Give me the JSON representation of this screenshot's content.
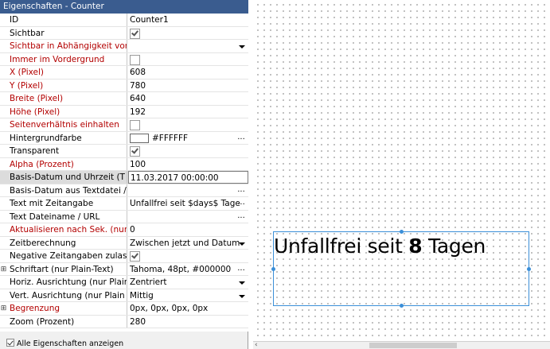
{
  "panel": {
    "title": "Eigenschaften - Counter",
    "show_all_label": "Alle Eigenschaften anzeigen"
  },
  "properties": [
    {
      "name": "ID",
      "value": "Counter1",
      "red": false
    },
    {
      "name": "Sichtbar",
      "value": "",
      "type": "checkbox",
      "checked": true,
      "red": false
    },
    {
      "name": "Sichtbar in Abhängigkeit vor",
      "value": "",
      "type": "dropdown",
      "red": true
    },
    {
      "name": "Immer im Vordergrund",
      "value": "",
      "type": "checkbox",
      "checked": false,
      "red": true
    },
    {
      "name": "X (Pixel)",
      "value": "608",
      "red": true
    },
    {
      "name": "Y (Pixel)",
      "value": "780",
      "red": true
    },
    {
      "name": "Breite (Pixel)",
      "value": "640",
      "red": true
    },
    {
      "name": "Höhe (Pixel)",
      "value": "192",
      "red": true
    },
    {
      "name": "Seitenverhältnis einhalten",
      "value": "",
      "type": "checkbox",
      "checked": false,
      "red": true
    },
    {
      "name": "Hintergrundfarbe",
      "value": "#FFFFFF",
      "type": "color",
      "red": false
    },
    {
      "name": "Transparent",
      "value": "",
      "type": "checkbox",
      "checked": true,
      "red": false
    },
    {
      "name": "Alpha (Prozent)",
      "value": "100",
      "red": true
    },
    {
      "name": "Basis-Datum und Uhrzeit (T",
      "value": "11.03.2017 00:00:00",
      "selected": true,
      "red": false
    },
    {
      "name": "Basis-Datum aus Textdatei /",
      "value": "",
      "type": "ellipsis",
      "red": false
    },
    {
      "name": "Text mit Zeitangabe",
      "value": "Unfallfrei seit $days$ Tage",
      "type": "ellipsis",
      "red": false
    },
    {
      "name": "Text Dateiname / URL",
      "value": "",
      "type": "ellipsis",
      "red": false
    },
    {
      "name": "Aktualisieren nach Sek. (nur",
      "value": "0",
      "red": true
    },
    {
      "name": "Zeitberechnung",
      "value": "Zwischen jetzt und Datum",
      "type": "dropdown",
      "red": false
    },
    {
      "name": "Negative Zeitangaben zulass",
      "value": "",
      "type": "checkbox",
      "checked": true,
      "red": false
    },
    {
      "name": "Schriftart (nur Plain-Text)",
      "value": "Tahoma, 48pt, #000000",
      "type": "ellipsis",
      "expand": true,
      "red": false
    },
    {
      "name": "Horiz. Ausrichtung (nur Plair",
      "value": "Zentriert",
      "type": "dropdown",
      "red": false
    },
    {
      "name": "Vert. Ausrichtung (nur Plain",
      "value": "Mittig",
      "type": "dropdown",
      "red": false
    },
    {
      "name": "Begrenzung",
      "value": "0px, 0px, 0px, 0px",
      "expand": true,
      "red": true
    },
    {
      "name": "Zoom (Prozent)",
      "value": "280",
      "red": false
    }
  ],
  "canvas": {
    "counter_prefix": "Unfallfrei seit ",
    "counter_number": "8",
    "counter_suffix": " Tagen"
  },
  "scrollbar": {
    "left_arrow": "‹"
  },
  "colors": {
    "title_bar": "#3a5c8f",
    "required_label": "#b30000",
    "selection_border": "#3b8fd8"
  }
}
